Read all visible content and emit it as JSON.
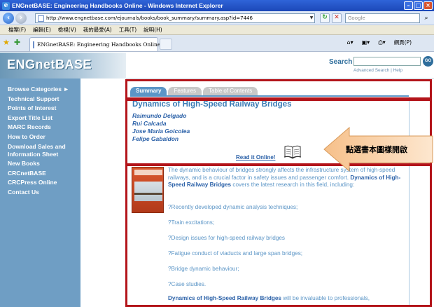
{
  "browser": {
    "window_title": "ENGnetBASE: Engineering Handbooks Online - Windows Internet Explorer",
    "url": "http://www.engnetbase.com/ejournals/books/book_summary/summary.asp?id=7446",
    "search_placeholder": "Google",
    "menu": [
      "檔案(F)",
      "編輯(E)",
      "檢視(V)",
      "我的最愛(A)",
      "工具(T)",
      "說明(H)"
    ],
    "tab_label": "ENGnetBASE: Engineering Handbooks Online",
    "page_menu": "網頁(P)"
  },
  "site": {
    "logo": "ENGnetBASE",
    "search_label": "Search",
    "go_label": "GO",
    "links": "Advanced Search | Help"
  },
  "sidebar": {
    "items": [
      "Browse Categories ►",
      "Technical Support",
      "Points of Interest",
      "Export Title List",
      "MARC Records",
      "How to Order",
      "Download Sales and Information Sheet",
      "New Books",
      "CRCnetBASE",
      "CRCPress Online",
      "Contact Us"
    ]
  },
  "content": {
    "tabs": [
      "Summary",
      "Features",
      "Table of Contents"
    ],
    "title": "Dynamics of High-Speed Railway Bridges",
    "authors": [
      "Raimundo Delgado",
      "Rui Calcada",
      "Jose Maria Goicolea",
      "Felipe Gabaldon"
    ],
    "read_online": "Read it Online!",
    "desc_part1": "The dynamic behaviour of bridges strongly affects the infrastructure system of high-speed railways, and is a crucial factor in safety issues and passenger comfort. ",
    "desc_bold": "Dynamics of High-Speed Railway Bridges",
    "desc_part2": " covers the latest research in this field, including:",
    "bullets": [
      "?Recently developed dynamic analysis techniques;",
      "?Train excitations;",
      "?Design issues for high-speed railway bridges",
      "?Fatigue conduct of viaducts and large span bridges;",
      "?Bridge dynamic behaviour;",
      "?Case studies."
    ],
    "closing_bold": "Dynamics of High-Speed Railway Bridges",
    "closing_rest": " will be invaluable to professionals,"
  },
  "annotation": {
    "callout_text": "點選書本圖樣開啟",
    "box_color": "#b3141a"
  },
  "colors": {
    "sidebar_bg": "#6f9ec4",
    "accent_blue": "#5b95c6",
    "link_blue": "#2b61a8",
    "title_blue": "#3a7bb5"
  }
}
